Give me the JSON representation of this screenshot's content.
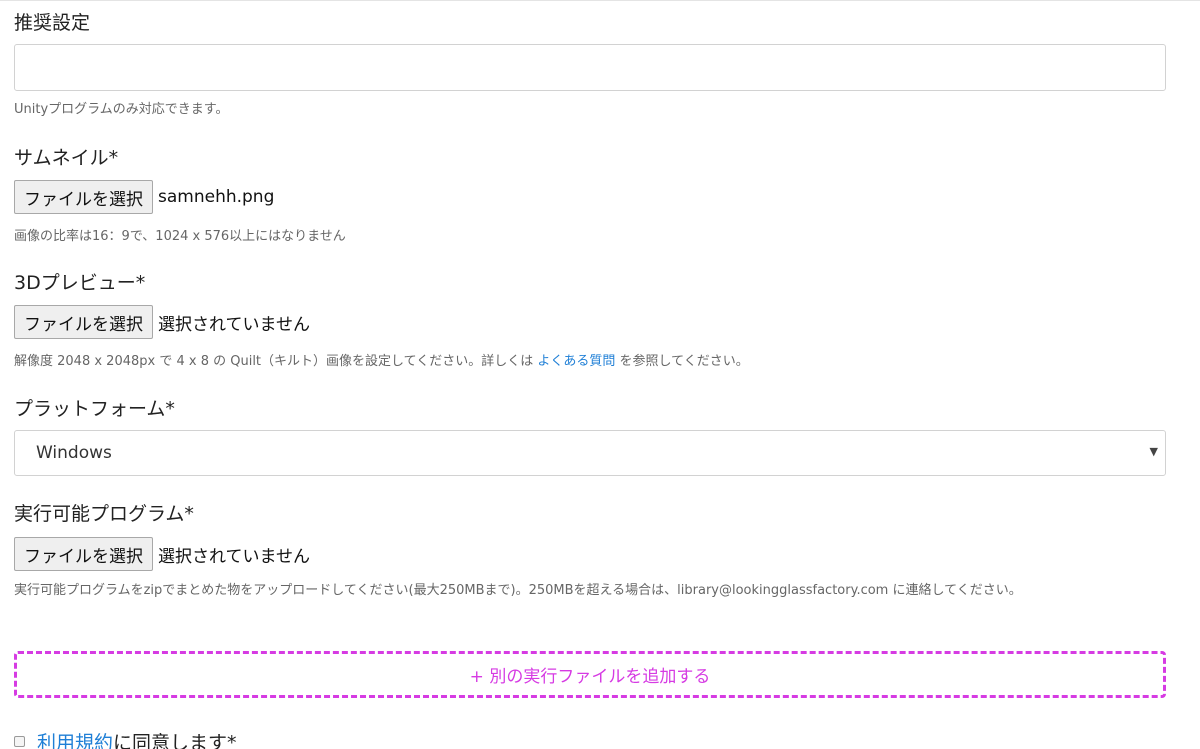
{
  "recommended": {
    "label": "推奨設定",
    "value": "",
    "help": "Unityプログラムのみ対応できます。"
  },
  "thumbnail": {
    "label": "サムネイル*",
    "button_label": "ファイルを選択",
    "file_name": "samnehh.png",
    "help": "画像の比率は16：9で、1024 x 576以上にはなりません"
  },
  "preview3d": {
    "label": "3Dプレビュー*",
    "button_label": "ファイルを選択",
    "file_name": "選択されていません",
    "help_prefix": "解像度 2048 x 2048px で 4 x 8 の Quilt（キルト）画像を設定してください。詳しくは ",
    "help_link": "よくある質問",
    "help_suffix": " を参照してください。"
  },
  "platform": {
    "label": "プラットフォーム*",
    "selected": "Windows",
    "arrow_icon": "caret-down-icon"
  },
  "executable": {
    "label": "実行可能プログラム*",
    "button_label": "ファイルを選択",
    "file_name": "選択されていません",
    "help": "実行可能プログラムをzipでまとめた物をアップロードしてください(最大250MBまで)。250MBを超える場合は、library@lookingglassfactory.com に連絡してください。"
  },
  "add_executable": {
    "label": "+ 別の実行ファイルを追加する",
    "border_color": "#d63be3"
  },
  "terms": {
    "link": "利用規約",
    "suffix": " に同意します*",
    "checked": false
  },
  "colors": {
    "link": "#1f7fd6",
    "help_text": "#666666",
    "accent": "#d63be3"
  }
}
